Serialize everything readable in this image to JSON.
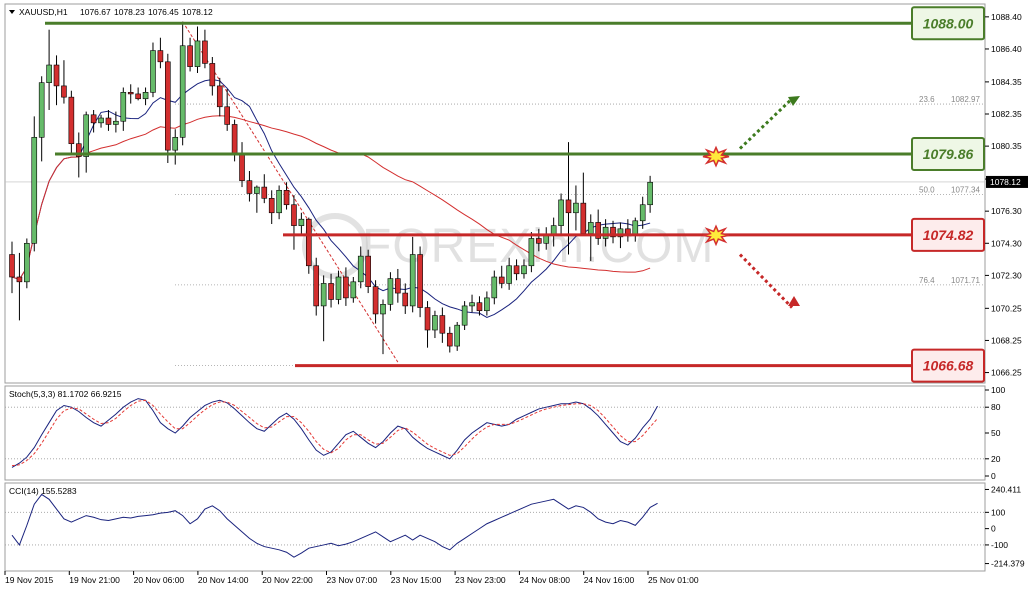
{
  "chart_data": [
    {
      "type": "candlestick",
      "symbol": "XAUUSD,H1",
      "ohlc_header": [
        "1076.67",
        "1078.23",
        "1076.45",
        "1078.12"
      ],
      "current_price": 1078.12,
      "current_price_label": "1078.12",
      "ylim": [
        1065.6,
        1089.2
      ],
      "y_ticks": [
        "1088.40",
        "1086.40",
        "1084.35",
        "1082.35",
        "1080.35",
        "1078.30",
        "1076.30",
        "1074.30",
        "1072.30",
        "1070.25",
        "1068.25",
        "1066.25"
      ],
      "x_ticks": [
        "19 Nov 2015",
        "19 Nov 21:00",
        "20 Nov 06:00",
        "20 Nov 14:00",
        "20 Nov 22:00",
        "23 Nov 07:00",
        "23 Nov 15:00",
        "23 Nov 23:00",
        "24 Nov 08:00",
        "24 Nov 16:00",
        "25 Nov 01:00"
      ],
      "candles": [
        [
          1073.6,
          1074.4,
          1071.2,
          1072.2
        ],
        [
          1072.2,
          1073.7,
          1069.5,
          1071.9
        ],
        [
          1071.9,
          1074.6,
          1071.5,
          1074.3
        ],
        [
          1074.3,
          1082.2,
          1073.8,
          1080.9
        ],
        [
          1080.9,
          1084.7,
          1079.4,
          1084.3
        ],
        [
          1084.3,
          1087.6,
          1082.6,
          1085.4
        ],
        [
          1085.4,
          1086.0,
          1082.9,
          1084.1
        ],
        [
          1084.1,
          1085.7,
          1083.0,
          1083.4
        ],
        [
          1083.4,
          1083.8,
          1079.8,
          1080.5
        ],
        [
          1080.5,
          1081.2,
          1078.4,
          1079.7
        ],
        [
          1079.7,
          1082.5,
          1078.7,
          1082.3
        ],
        [
          1082.3,
          1082.6,
          1081.2,
          1081.8
        ],
        [
          1081.8,
          1082.3,
          1081.5,
          1082.1
        ],
        [
          1082.1,
          1082.6,
          1081.3,
          1081.7
        ],
        [
          1081.7,
          1082.5,
          1081.2,
          1081.9
        ],
        [
          1081.9,
          1084.0,
          1081.3,
          1083.7
        ],
        [
          1083.7,
          1084.2,
          1083.0,
          1083.6
        ],
        [
          1083.6,
          1084.0,
          1083.2,
          1083.3
        ],
        [
          1083.3,
          1084.0,
          1082.9,
          1083.7
        ],
        [
          1083.7,
          1086.8,
          1083.4,
          1086.3
        ],
        [
          1086.3,
          1087.1,
          1085.2,
          1085.6
        ],
        [
          1085.6,
          1086.1,
          1079.3,
          1080.1
        ],
        [
          1080.1,
          1081.4,
          1079.2,
          1080.9
        ],
        [
          1080.9,
          1088.1,
          1080.4,
          1086.6
        ],
        [
          1086.6,
          1087.1,
          1085.0,
          1085.3
        ],
        [
          1085.3,
          1087.8,
          1084.9,
          1086.9
        ],
        [
          1086.9,
          1087.6,
          1085.2,
          1085.5
        ],
        [
          1085.5,
          1085.9,
          1083.5,
          1084.1
        ],
        [
          1084.1,
          1084.6,
          1082.2,
          1082.8
        ],
        [
          1082.8,
          1083.9,
          1081.3,
          1081.7
        ],
        [
          1081.7,
          1082.0,
          1079.4,
          1079.8
        ],
        [
          1079.8,
          1080.6,
          1077.8,
          1078.2
        ],
        [
          1078.2,
          1078.8,
          1076.9,
          1077.4
        ],
        [
          1077.4,
          1077.9,
          1076.2,
          1077.8
        ],
        [
          1077.8,
          1078.6,
          1076.8,
          1077.1
        ],
        [
          1077.1,
          1077.6,
          1075.5,
          1076.2
        ],
        [
          1076.2,
          1077.9,
          1075.8,
          1077.6
        ],
        [
          1077.6,
          1078.1,
          1076.4,
          1076.7
        ],
        [
          1076.7,
          1077.3,
          1073.9,
          1075.4
        ],
        [
          1075.4,
          1076.2,
          1074.9,
          1075.8
        ],
        [
          1075.8,
          1075.9,
          1072.4,
          1072.9
        ],
        [
          1072.9,
          1073.4,
          1069.8,
          1070.4
        ],
        [
          1070.4,
          1072.3,
          1068.2,
          1071.8
        ],
        [
          1071.8,
          1072.4,
          1070.3,
          1070.8
        ],
        [
          1070.8,
          1072.6,
          1070.5,
          1072.2
        ],
        [
          1072.2,
          1072.8,
          1070.4,
          1070.9
        ],
        [
          1070.9,
          1072.2,
          1070.6,
          1071.9
        ],
        [
          1071.9,
          1074.1,
          1071.5,
          1073.5
        ],
        [
          1073.5,
          1073.9,
          1071.2,
          1071.6
        ],
        [
          1071.6,
          1072.0,
          1069.3,
          1069.9
        ],
        [
          1069.9,
          1070.8,
          1067.4,
          1070.5
        ],
        [
          1070.5,
          1072.5,
          1070.1,
          1072.1
        ],
        [
          1072.1,
          1072.7,
          1070.6,
          1071.2
        ],
        [
          1071.2,
          1071.8,
          1069.9,
          1070.4
        ],
        [
          1070.4,
          1074.7,
          1070.0,
          1073.6
        ],
        [
          1073.6,
          1074.1,
          1069.7,
          1070.3
        ],
        [
          1070.3,
          1070.7,
          1067.8,
          1068.9
        ],
        [
          1068.9,
          1070.1,
          1068.4,
          1069.8
        ],
        [
          1069.8,
          1070.3,
          1068.1,
          1068.7
        ],
        [
          1068.7,
          1069.1,
          1067.5,
          1067.9
        ],
        [
          1067.9,
          1069.4,
          1067.6,
          1069.2
        ],
        [
          1069.2,
          1070.7,
          1068.9,
          1070.4
        ],
        [
          1070.4,
          1071.1,
          1070.0,
          1070.6
        ],
        [
          1070.6,
          1071.0,
          1069.8,
          1070.1
        ],
        [
          1070.1,
          1071.3,
          1069.8,
          1070.9
        ],
        [
          1070.9,
          1072.6,
          1070.5,
          1072.2
        ],
        [
          1072.2,
          1072.9,
          1071.5,
          1071.8
        ],
        [
          1071.8,
          1073.4,
          1071.4,
          1072.9
        ],
        [
          1072.9,
          1073.3,
          1072.0,
          1072.4
        ],
        [
          1072.4,
          1073.3,
          1072.1,
          1072.9
        ],
        [
          1072.9,
          1075.0,
          1072.5,
          1074.6
        ],
        [
          1074.6,
          1075.2,
          1073.8,
          1074.3
        ],
        [
          1074.3,
          1075.3,
          1073.9,
          1074.8
        ],
        [
          1074.8,
          1075.9,
          1074.1,
          1075.4
        ],
        [
          1075.4,
          1077.4,
          1074.9,
          1077.0
        ],
        [
          1077.0,
          1080.6,
          1073.6,
          1076.2
        ],
        [
          1076.2,
          1077.9,
          1075.1,
          1076.8
        ],
        [
          1076.8,
          1078.7,
          1075.7,
          1074.9
        ],
        [
          1074.9,
          1076.1,
          1073.2,
          1075.6
        ],
        [
          1075.6,
          1076.4,
          1074.2,
          1074.6
        ],
        [
          1074.6,
          1075.8,
          1074.1,
          1075.3
        ],
        [
          1075.3,
          1075.7,
          1074.3,
          1074.7
        ],
        [
          1074.7,
          1075.6,
          1074.0,
          1075.2
        ],
        [
          1075.2,
          1075.8,
          1074.4,
          1074.8
        ],
        [
          1074.8,
          1075.9,
          1074.4,
          1075.7
        ],
        [
          1075.7,
          1077.2,
          1075.2,
          1076.7
        ],
        [
          1076.7,
          1078.5,
          1076.2,
          1078.1
        ]
      ],
      "ma_fast_color": "#1a237e",
      "ma_slow_color": "#d32f2f",
      "fib_levels": [
        {
          "ratio": "23.6",
          "price": 1082.97,
          "label": "1082.97"
        },
        {
          "ratio": "50.0",
          "price": 1077.34,
          "label": "1077.34"
        },
        {
          "ratio": "76.4",
          "price": 1071.71,
          "label": "1071.71"
        }
      ],
      "levels": [
        {
          "price": 1088.0,
          "label": "1088.00",
          "kind": "resistance",
          "color": "#4a7d2a"
        },
        {
          "price": 1079.86,
          "label": "1079.86",
          "kind": "resistance",
          "color": "#4a7d2a"
        },
        {
          "price": 1074.82,
          "label": "1074.82",
          "kind": "support",
          "color": "#c62828"
        },
        {
          "price": 1066.68,
          "label": "1066.68",
          "kind": "support",
          "color": "#c62828"
        }
      ],
      "arrow_up_color": "#3d7a1e",
      "arrow_down_color": "#c62828"
    },
    {
      "type": "line",
      "indicator": "Stoch",
      "label": "Stoch(5,3,3) 81.1702 66.9215",
      "ylim": [
        0,
        100
      ],
      "y_ticks": [
        "100",
        "80",
        "50",
        "20",
        "0"
      ],
      "series": [
        {
          "values": [
            10,
            15,
            22,
            33,
            48,
            62,
            76,
            82,
            80,
            75,
            68,
            62,
            58,
            65,
            72,
            80,
            86,
            90,
            88,
            76,
            62,
            55,
            50,
            58,
            68,
            75,
            82,
            86,
            88,
            85,
            78,
            70,
            62,
            55,
            52,
            60,
            68,
            73,
            66,
            55,
            42,
            30,
            24,
            28,
            38,
            48,
            52,
            45,
            38,
            33,
            40,
            50,
            58,
            55,
            45,
            38,
            32,
            28,
            24,
            20,
            30,
            42,
            50,
            56,
            62,
            60,
            58,
            60,
            66,
            70,
            74,
            78,
            80,
            82,
            84,
            84,
            86,
            84,
            78,
            70,
            60,
            50,
            40,
            36,
            44,
            56,
            66,
            81.2
          ]
        },
        {
          "values": [
            12,
            13,
            18,
            26,
            38,
            52,
            66,
            76,
            79,
            78,
            72,
            66,
            61,
            62,
            67,
            75,
            82,
            87,
            88,
            82,
            72,
            63,
            55,
            55,
            62,
            70,
            77,
            83,
            86,
            86,
            82,
            75,
            68,
            61,
            56,
            57,
            63,
            69,
            69,
            62,
            52,
            40,
            31,
            27,
            32,
            42,
            48,
            48,
            42,
            37,
            38,
            45,
            53,
            56,
            51,
            44,
            37,
            32,
            28,
            24,
            26,
            34,
            43,
            51,
            57,
            60,
            60,
            60,
            63,
            67,
            71,
            75,
            78,
            80,
            82,
            83,
            84,
            84,
            82,
            76,
            67,
            57,
            47,
            40,
            40,
            47,
            57,
            66.9
          ]
        }
      ]
    },
    {
      "type": "line",
      "indicator": "CCI",
      "label": "CCI(14) 155.5283",
      "ylim": [
        -260,
        280
      ],
      "y_ticks": [
        "240.411",
        "100",
        "0",
        "-100",
        "-214.379"
      ],
      "series": [
        {
          "values": [
            -40,
            -100,
            20,
            150,
            210,
            180,
            120,
            60,
            40,
            60,
            80,
            70,
            55,
            50,
            60,
            70,
            65,
            75,
            80,
            85,
            95,
            100,
            110,
            80,
            30,
            60,
            120,
            140,
            110,
            60,
            20,
            -20,
            -60,
            -90,
            -110,
            -120,
            -130,
            -145,
            -175,
            -150,
            -120,
            -110,
            -100,
            -90,
            -105,
            -95,
            -80,
            -60,
            -40,
            -20,
            -50,
            -80,
            -60,
            -40,
            -70,
            -40,
            -60,
            -80,
            -110,
            -130,
            -90,
            -60,
            -30,
            0,
            30,
            50,
            70,
            90,
            110,
            130,
            150,
            160,
            170,
            180,
            150,
            120,
            140,
            130,
            100,
            60,
            40,
            30,
            50,
            40,
            20,
            70,
            130,
            155.5
          ]
        }
      ]
    }
  ]
}
